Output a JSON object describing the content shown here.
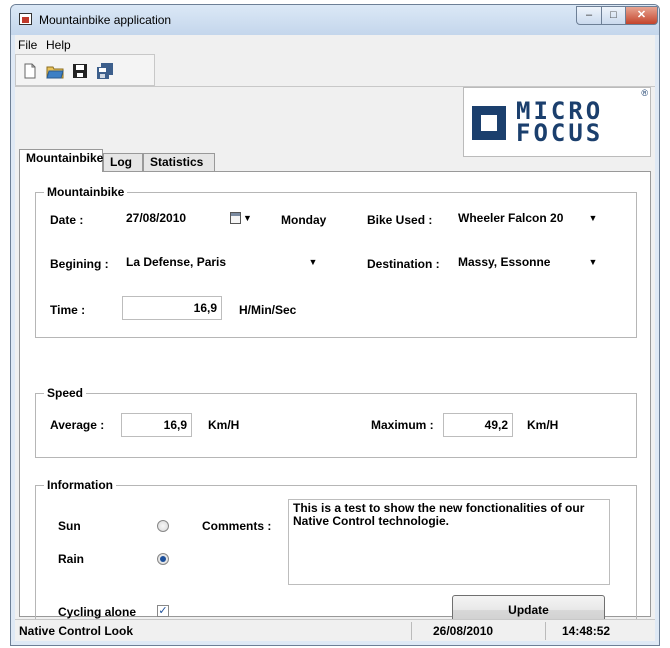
{
  "window": {
    "title": "Mountainbike application"
  },
  "menu": [
    "File",
    "Help"
  ],
  "toolbar": {
    "icons": [
      "new-document-icon",
      "open-folder-icon",
      "save-icon",
      "save-all-icon"
    ]
  },
  "logo": {
    "line1": "MICRO",
    "line2": "FOCUS",
    "registered": "®"
  },
  "tabs": [
    "Mountainbike",
    "Log",
    "Statistics"
  ],
  "mountainbike_group": {
    "legend": "Mountainbike",
    "date_label": "Date :",
    "date_value": "27/08/2010",
    "day": "Monday",
    "bike_used_label": "Bike Used :",
    "bike_used_value": "Wheeler Falcon 20",
    "begining_label": "Begining :",
    "begining_value": "La Defense, Paris",
    "destination_label": "Destination :",
    "destination_value": "Massy, Essonne",
    "time_label": "Time :",
    "time_value": "16,9",
    "time_unit": "H/Min/Sec"
  },
  "speed_group": {
    "legend": "Speed",
    "average_label": "Average :",
    "average_value": "16,9",
    "average_unit": "Km/H",
    "maximum_label": "Maximum :",
    "maximum_value": "49,2",
    "maximum_unit": "Km/H"
  },
  "information_group": {
    "legend": "Information",
    "sun_label": "Sun",
    "rain_label": "Rain",
    "weather_selected": "Rain",
    "comments_label": "Comments :",
    "comments_text": "This is a test to show the new fonctionalities of our Native Control technologie.",
    "cycling_alone_label": "Cycling alone",
    "cycling_alone_checked": true,
    "update_button": "Update"
  },
  "statusbar": {
    "left": "Native Control Look",
    "date": "26/08/2010",
    "time": "14:48:52"
  }
}
